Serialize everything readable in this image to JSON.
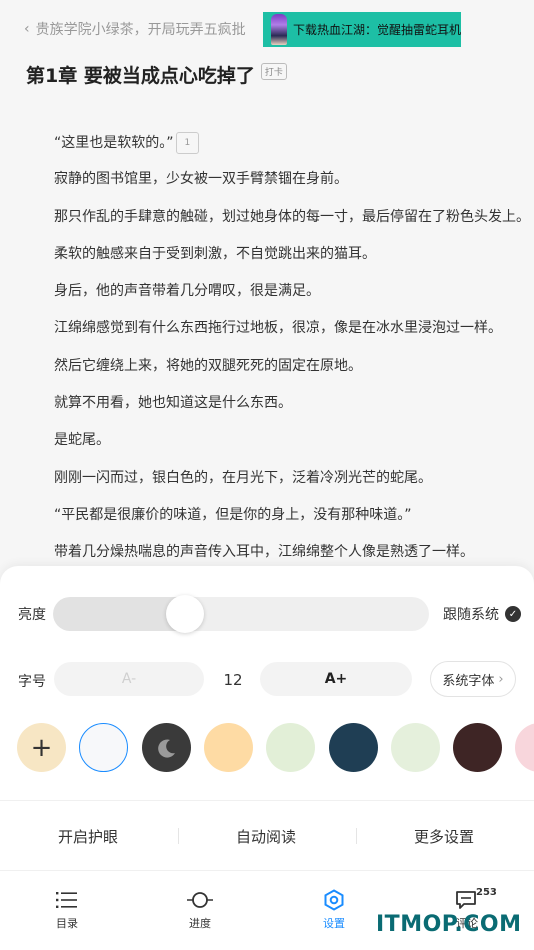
{
  "header": {
    "back_label": "贵族学院小绿茶，开局玩弄五疯批",
    "ad_text": "下载热血江湖：觉醒抽雷蛇耳机"
  },
  "chapter": {
    "title": "第1章 要被当成点心吃掉了",
    "tag": "打卡",
    "paragraphs": [
      "“这里也是软软的。”",
      "寂静的图书馆里，少女被一双手臂禁锢在身前。",
      "那只作乱的手肆意的触碰，划过她身体的每一寸，最后停留在了粉色头发上。",
      "柔软的触感来自于受到刺激，不自觉跳出来的猫耳。",
      "身后，他的声音带着几分喟叹，很是满足。",
      "江绵绵感觉到有什么东西拖行过地板，很凉，像是在冰水里浸泡过一样。",
      "然后它缠绕上来，将她的双腿死死的固定在原地。",
      "就算不用看，她也知道这是什么东西。",
      "是蛇尾。",
      "刚刚一闪而过，银白色的，在月光下，泛着冷冽光芒的蛇尾。",
      "“平民都是很廉价的味道，但是你的身上，没有那种味道。”",
      "带着几分燥热喘息的声音传入耳中，江绵绵整个人像是熟透了一样。"
    ],
    "first_para_comment_count": "1"
  },
  "settings": {
    "brightness_label": "亮度",
    "brightness_level": 0.35,
    "follow_system_label": "跟随系统",
    "font_label": "字号",
    "font_decrease": "A-",
    "font_increase": "A+",
    "font_size": "12",
    "system_font_label": "系统字体",
    "add_theme_symbol": "+",
    "themes": [
      {
        "name": "add",
        "color": "#f7e6c4"
      },
      {
        "name": "white",
        "color": "#f7f8fa"
      },
      {
        "name": "night",
        "color": "#3a3a3a"
      },
      {
        "name": "yellow",
        "color": "#fedba4"
      },
      {
        "name": "green-light",
        "color": "#e2efd7"
      },
      {
        "name": "navy",
        "color": "#1f3e54"
      },
      {
        "name": "green-pale",
        "color": "#e5f0dc"
      },
      {
        "name": "brown",
        "color": "#3e2525"
      },
      {
        "name": "pink",
        "color": "#f8d6dc"
      }
    ],
    "options": [
      "开启护眼",
      "自动阅读",
      "更多设置"
    ]
  },
  "tabbar": {
    "tabs": [
      {
        "label": "目录",
        "icon": "list-icon"
      },
      {
        "label": "进度",
        "icon": "progress-icon"
      },
      {
        "label": "设置",
        "icon": "settings-icon"
      },
      {
        "label": "评论",
        "icon": "comment-icon"
      }
    ],
    "comment_badge": "253",
    "active_tab": "设置"
  },
  "watermark": "ITMOP.COM",
  "colors": {
    "accent": "#1a8cff",
    "ad_bg": "#1dbfa5"
  }
}
